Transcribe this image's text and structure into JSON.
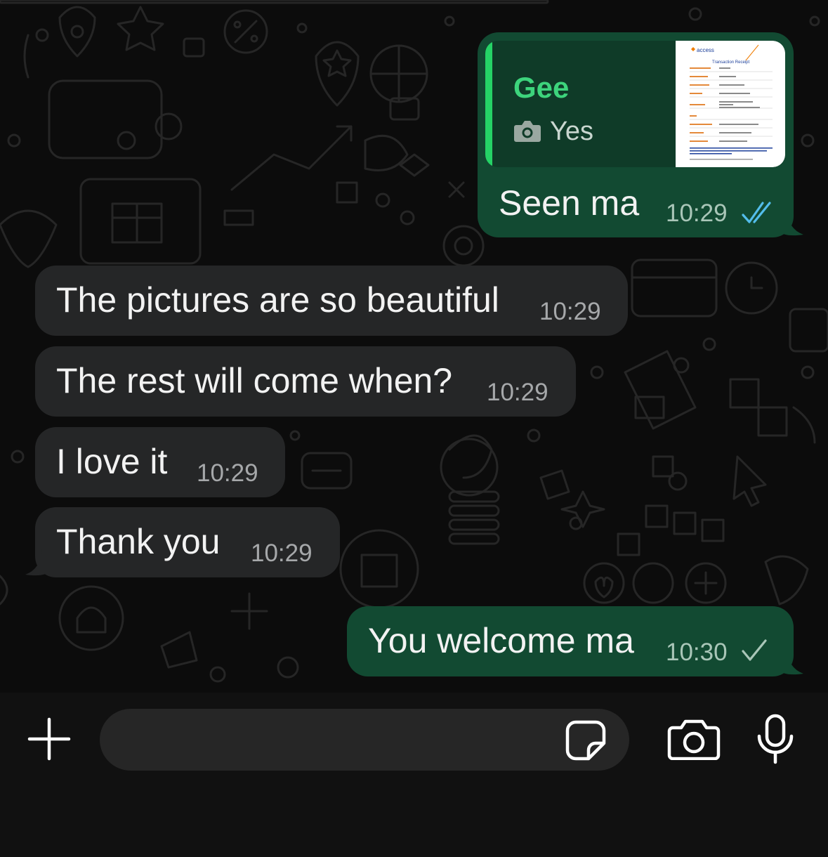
{
  "messages": [
    {
      "id": "m1",
      "direction": "out",
      "quote": {
        "author": "Gee",
        "text": "Yes",
        "media_icon": "camera-icon",
        "thumbnail": {
          "brand": "access",
          "heading": "Transaction Receipt"
        }
      },
      "text": "Seen ma",
      "time": "10:29",
      "status": "read",
      "status_icon": "double-check-icon"
    },
    {
      "id": "m2",
      "direction": "in",
      "text": "The pictures are so beautiful",
      "time": "10:29"
    },
    {
      "id": "m3",
      "direction": "in",
      "text": "The rest will come when?",
      "time": "10:29"
    },
    {
      "id": "m4",
      "direction": "in",
      "text": "I love it",
      "time": "10:29"
    },
    {
      "id": "m5",
      "direction": "in",
      "text": "Thank you",
      "time": "10:29"
    },
    {
      "id": "m6",
      "direction": "out",
      "text": "You welcome ma",
      "time": "10:30",
      "status": "sent",
      "status_icon": "single-check-icon"
    }
  ],
  "composer": {
    "input_value": "",
    "input_placeholder": "",
    "icons": [
      "plus-icon",
      "sticker-icon",
      "camera-icon",
      "microphone-icon"
    ]
  },
  "colors": {
    "background": "#0c0c0c",
    "incoming_bubble": "#252627",
    "outgoing_bubble": "#124a32",
    "read_ticks": "#53bdeb",
    "quote_accent": "#25d366"
  }
}
